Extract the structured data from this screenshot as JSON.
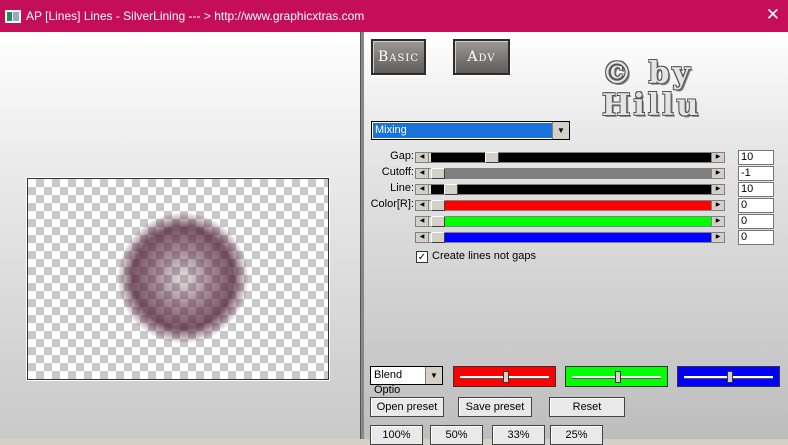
{
  "window": {
    "title": "AP [Lines]  Lines - SilverLining    --- > http://www.graphicxtras.com",
    "close_glyph": "✕"
  },
  "tabs": {
    "basic": "Basic",
    "adv": "Adv"
  },
  "watermark": {
    "line1": "© by",
    "line2": "Hillu"
  },
  "mode_select": {
    "value": "Mixing"
  },
  "params": [
    {
      "label": "Gap:",
      "value": "10",
      "fill": "#000000",
      "level": 0.2
    },
    {
      "label": "Cutoff:",
      "value": "-1",
      "fill": "#808080",
      "level": 0.0
    },
    {
      "label": "Line:",
      "value": "10",
      "fill": "#000000",
      "level": 0.05
    },
    {
      "label": "Color[R]:",
      "value": "0",
      "fill": "#ff0000",
      "level": 0.0
    },
    {
      "label": "",
      "value": "0",
      "fill": "#00ff00",
      "level": 0.0
    },
    {
      "label": "",
      "value": "0",
      "fill": "#0000ff",
      "level": 0.0
    }
  ],
  "create_lines": {
    "label": "Create lines not gaps",
    "checked": true,
    "mark": "✓"
  },
  "blend_select": {
    "value": "Blend Optio"
  },
  "color_bars": [
    {
      "color": "#ff0000",
      "level": 0.5
    },
    {
      "color": "#00ff00",
      "level": 0.5
    },
    {
      "color": "#0000ff",
      "level": 0.5
    }
  ],
  "buttons": {
    "open_preset": "Open preset",
    "save_preset": "Save preset",
    "reset": "Reset"
  },
  "zoom": [
    "100%",
    "50%",
    "33%",
    "25%"
  ]
}
